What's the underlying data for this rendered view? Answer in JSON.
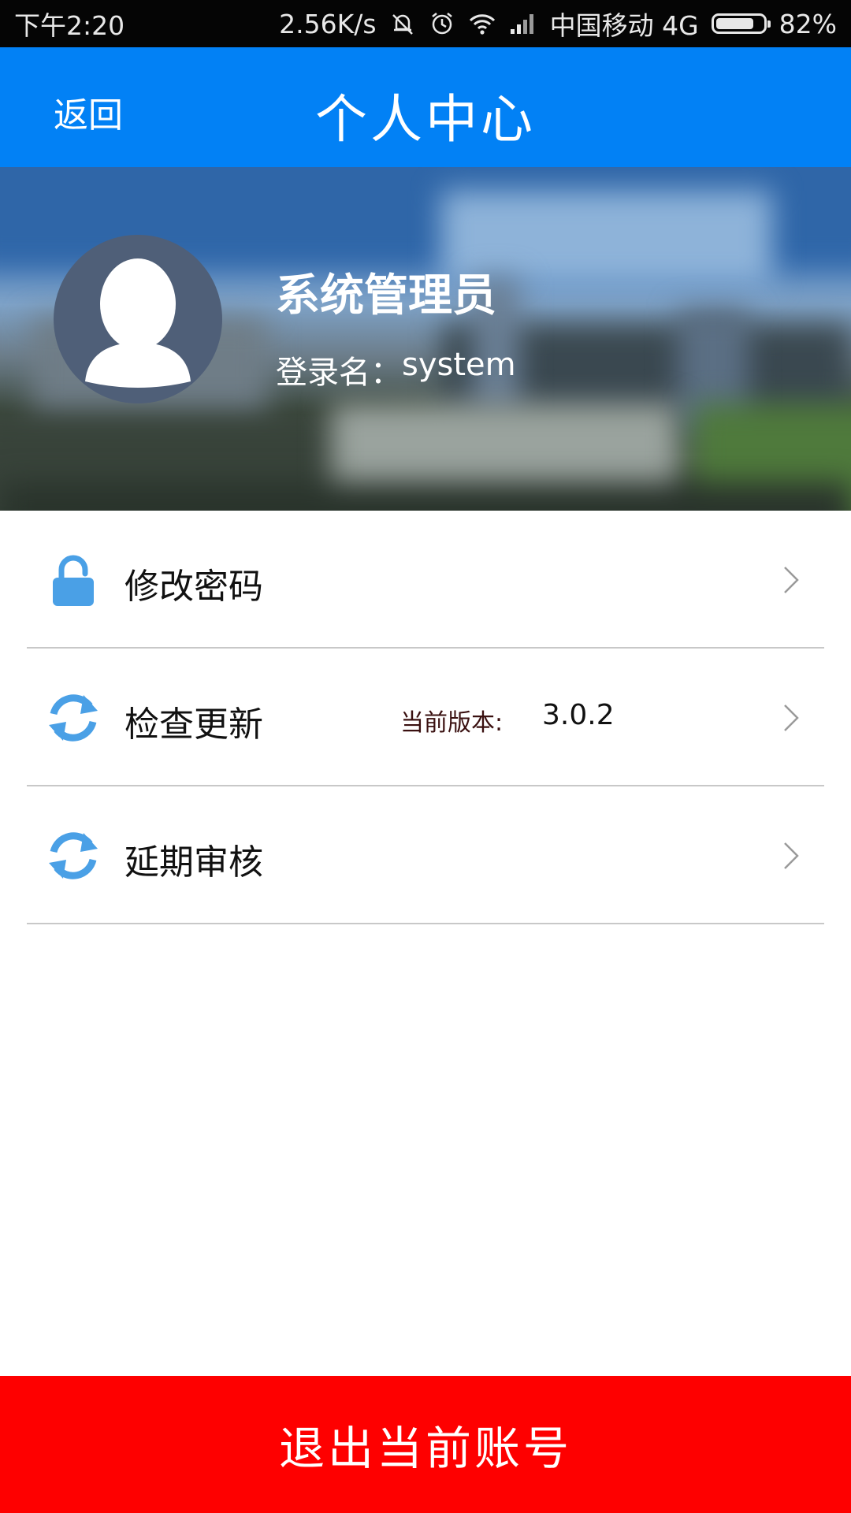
{
  "status_bar": {
    "time": "下午2:20",
    "net_speed": "2.56K/s",
    "carrier": "中国移动 4G",
    "battery_percent": "82%",
    "battery_level": 0.82,
    "icons": [
      "mute-icon",
      "alarm-icon",
      "wifi-icon",
      "signal-icon",
      "battery-icon"
    ]
  },
  "nav": {
    "back_label": "返回",
    "title": "个人中心",
    "color": "#0281f5"
  },
  "profile": {
    "name": "系统管理员",
    "login_label": "登录名：",
    "login_value": "system",
    "avatar_icon": "person-silhouette-icon"
  },
  "menu": [
    {
      "label": "修改密码",
      "icon": "lock-icon"
    },
    {
      "label": "检查更新",
      "icon": "refresh-icon",
      "version_label": "当前版本:",
      "version_value": "3.0.2"
    },
    {
      "label": "延期审核",
      "icon": "refresh-icon"
    }
  ],
  "logout": {
    "label": "退出当前账号",
    "color": "#fe0000"
  },
  "colors": {
    "icon_blue": "#4aa0e6",
    "chevron": "#9a9a9a"
  }
}
